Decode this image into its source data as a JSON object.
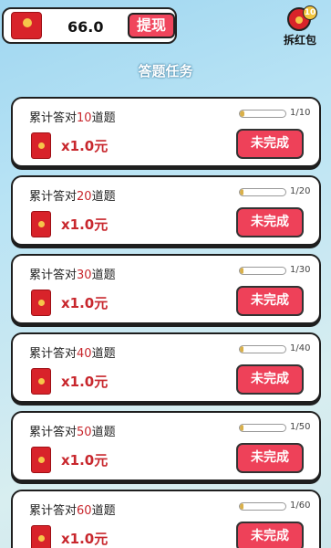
{
  "header": {
    "balance": "66.0",
    "withdraw_label": "提现",
    "grab_label": "拆红包",
    "grab_badge": "10"
  },
  "page_title": "答题任务",
  "tasks": [
    {
      "prefix": "累计答对",
      "num": "10",
      "suffix": "道题",
      "reward": "x1.0元",
      "progress_text": "1/10",
      "progress": 0.1,
      "status": "未完成"
    },
    {
      "prefix": "累计答对",
      "num": "20",
      "suffix": "道题",
      "reward": "x1.0元",
      "progress_text": "1/20",
      "progress": 0.05,
      "status": "未完成"
    },
    {
      "prefix": "累计答对",
      "num": "30",
      "suffix": "道题",
      "reward": "x1.0元",
      "progress_text": "1/30",
      "progress": 0.033,
      "status": "未完成"
    },
    {
      "prefix": "累计答对",
      "num": "40",
      "suffix": "道题",
      "reward": "x1.0元",
      "progress_text": "1/40",
      "progress": 0.025,
      "status": "未完成"
    },
    {
      "prefix": "累计答对",
      "num": "50",
      "suffix": "道题",
      "reward": "x1.0元",
      "progress_text": "1/50",
      "progress": 0.02,
      "status": "未完成"
    },
    {
      "prefix": "累计答对",
      "num": "60",
      "suffix": "道题",
      "reward": "x1.0元",
      "progress_text": "1/60",
      "progress": 0.017,
      "status": "未完成"
    }
  ]
}
